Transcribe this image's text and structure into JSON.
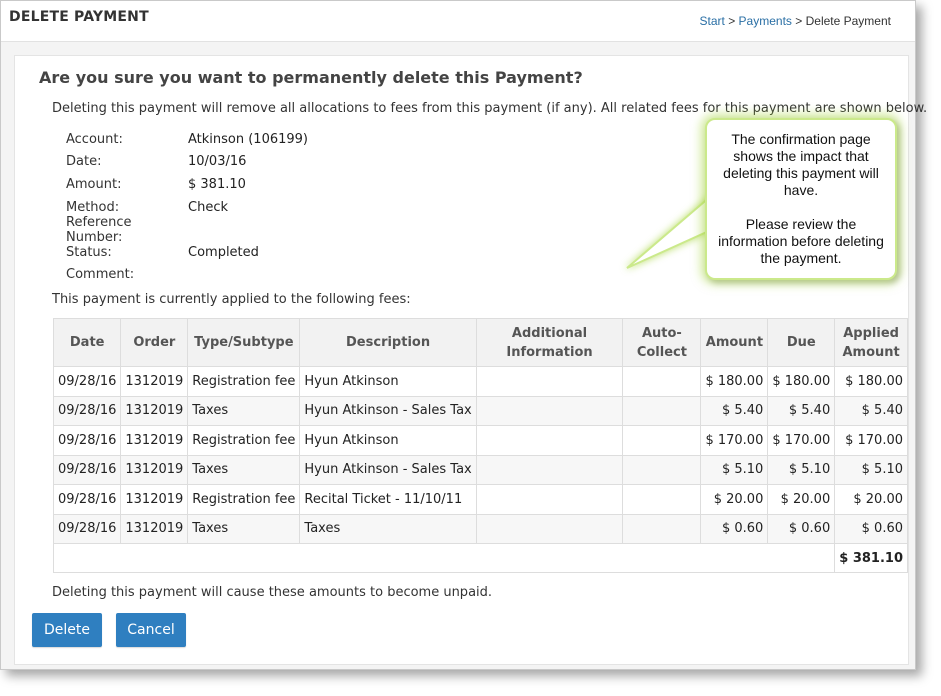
{
  "header": {
    "title": "DELETE PAYMENT",
    "breadcrumb": {
      "start": "Start",
      "sep1": ">",
      "payments": "Payments",
      "sep2": ">",
      "current": "Delete Payment"
    }
  },
  "confirm": {
    "heading": "Are you sure you want to permanently delete this Payment?",
    "intro": "Deleting this payment will remove all allocations to fees from this payment (if any). All related fees for this payment are shown below."
  },
  "details": [
    {
      "label": "Account:",
      "value": "Atkinson (106199)"
    },
    {
      "label": "Date:",
      "value": "10/03/16"
    },
    {
      "label": "Amount:",
      "value": "$ 381.10"
    },
    {
      "label": "Method:",
      "value": "Check"
    },
    {
      "label": "Reference Number:",
      "value": ""
    },
    {
      "label": "Status:",
      "value": "Completed"
    },
    {
      "label": "Comment:",
      "value": ""
    }
  ],
  "applied_text": "This payment is currently applied to the following fees:",
  "table": {
    "headers": [
      "Date",
      "Order",
      "Type/Subtype",
      "Description",
      "Additional Information",
      "Auto-Collect",
      "Amount",
      "Due",
      "Applied Amount"
    ],
    "rows": [
      [
        "09/28/16",
        "1312019",
        "Registration fee",
        "Hyun Atkinson",
        "",
        "",
        "$ 180.00",
        "$ 180.00",
        "$ 180.00"
      ],
      [
        "09/28/16",
        "1312019",
        "Taxes",
        "Hyun Atkinson - Sales Tax",
        "",
        "",
        "$ 5.40",
        "$ 5.40",
        "$ 5.40"
      ],
      [
        "09/28/16",
        "1312019",
        "Registration fee",
        "Hyun Atkinson",
        "",
        "",
        "$ 170.00",
        "$ 170.00",
        "$ 170.00"
      ],
      [
        "09/28/16",
        "1312019",
        "Taxes",
        "Hyun Atkinson - Sales Tax",
        "",
        "",
        "$ 5.10",
        "$ 5.10",
        "$ 5.10"
      ],
      [
        "09/28/16",
        "1312019",
        "Registration fee",
        "Recital Ticket - 11/10/11",
        "",
        "",
        "$ 20.00",
        "$ 20.00",
        "$ 20.00"
      ],
      [
        "09/28/16",
        "1312019",
        "Taxes",
        "Taxes",
        "",
        "",
        "$ 0.60",
        "$ 0.60",
        "$ 0.60"
      ]
    ],
    "total": "$ 381.10"
  },
  "unpaid_text": "Deleting this payment will cause these amounts to become unpaid.",
  "buttons": {
    "delete": "Delete",
    "cancel": "Cancel"
  },
  "callout": {
    "line1": "The confirmation page shows the impact that deleting this payment will have.",
    "line2": "Please review the information before deleting the payment."
  },
  "colors": {
    "primary_button": "#2f7fc0",
    "link": "#2a6fa5",
    "callout_border": "#cbe98b"
  }
}
